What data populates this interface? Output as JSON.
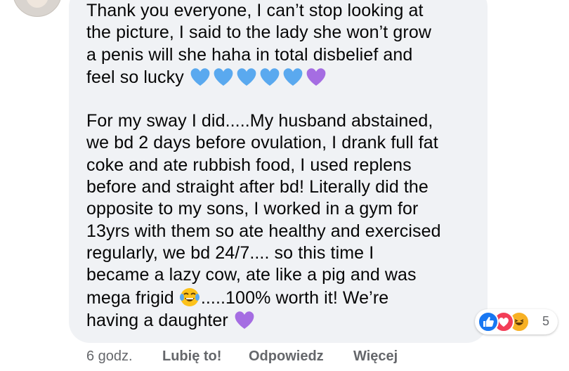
{
  "comment": {
    "paragraph1": [
      "Thank you everyone, I can’t stop looking at",
      "the picture, I said to the lady she won’t grow",
      "a penis will she haha in total disbelief and",
      "feel so lucky"
    ],
    "paragraph2": [
      "For my sway I did.....My husband abstained,",
      "we bd 2 days before ovulation, I drank full fat",
      "coke and ate rubbish food, I used replens",
      "before and straight after bd! Literally did the",
      "opposite to my sons, I worked in a gym for",
      "13yrs with them so ate healthy and exercised",
      "regularly, we bd 24/7.... so this time I",
      "became a lazy cow, ate like a pig and was"
    ],
    "line_mega": "mega frigid",
    "line_mega_after": ".....100% worth it! We’re",
    "line_last": "having a daughter"
  },
  "emojis": {
    "blue_heart_color": "#5aa9ef",
    "purple_heart_color": "#a56de2",
    "row1": [
      "blue-heart-icon",
      "blue-heart-icon",
      "blue-heart-icon",
      "blue-heart-icon",
      "blue-heart-icon",
      "purple-heart-icon"
    ],
    "laughing_face": "tears-of-joy-icon"
  },
  "reactions": {
    "types": [
      "like-icon",
      "love-icon",
      "haha-icon"
    ],
    "count": "5",
    "colors": {
      "like": "#1877f2",
      "love": "#f33e58",
      "haha": "#f7b125"
    }
  },
  "actions": {
    "time": "6 godz.",
    "like": "Lubię to!",
    "reply": "Odpowiedz",
    "more": "Więcej"
  }
}
